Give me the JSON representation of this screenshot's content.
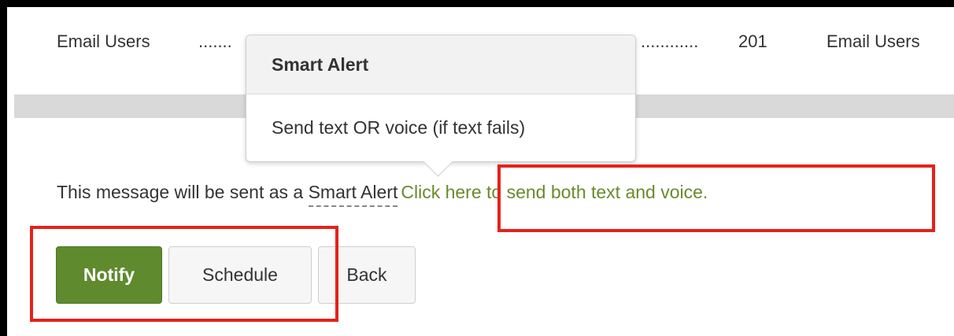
{
  "top_row": {
    "left_label": "Email Users",
    "left_dots": ".......",
    "right_dots": "............",
    "count": "201",
    "right_label": "Email Users"
  },
  "tooltip": {
    "title": "Smart Alert",
    "option": "Send text OR voice (if text fails)"
  },
  "message": {
    "prefix": "This message will be sent as a",
    "smart_alert": "Smart Alert",
    "link": "Click here to send both text and voice."
  },
  "buttons": {
    "notify": "Notify",
    "schedule": "Schedule",
    "back": "Back"
  },
  "colors": {
    "primary_button": "#5f8a2e",
    "link": "#6a8a2b",
    "highlight_box": "#e5221a"
  }
}
